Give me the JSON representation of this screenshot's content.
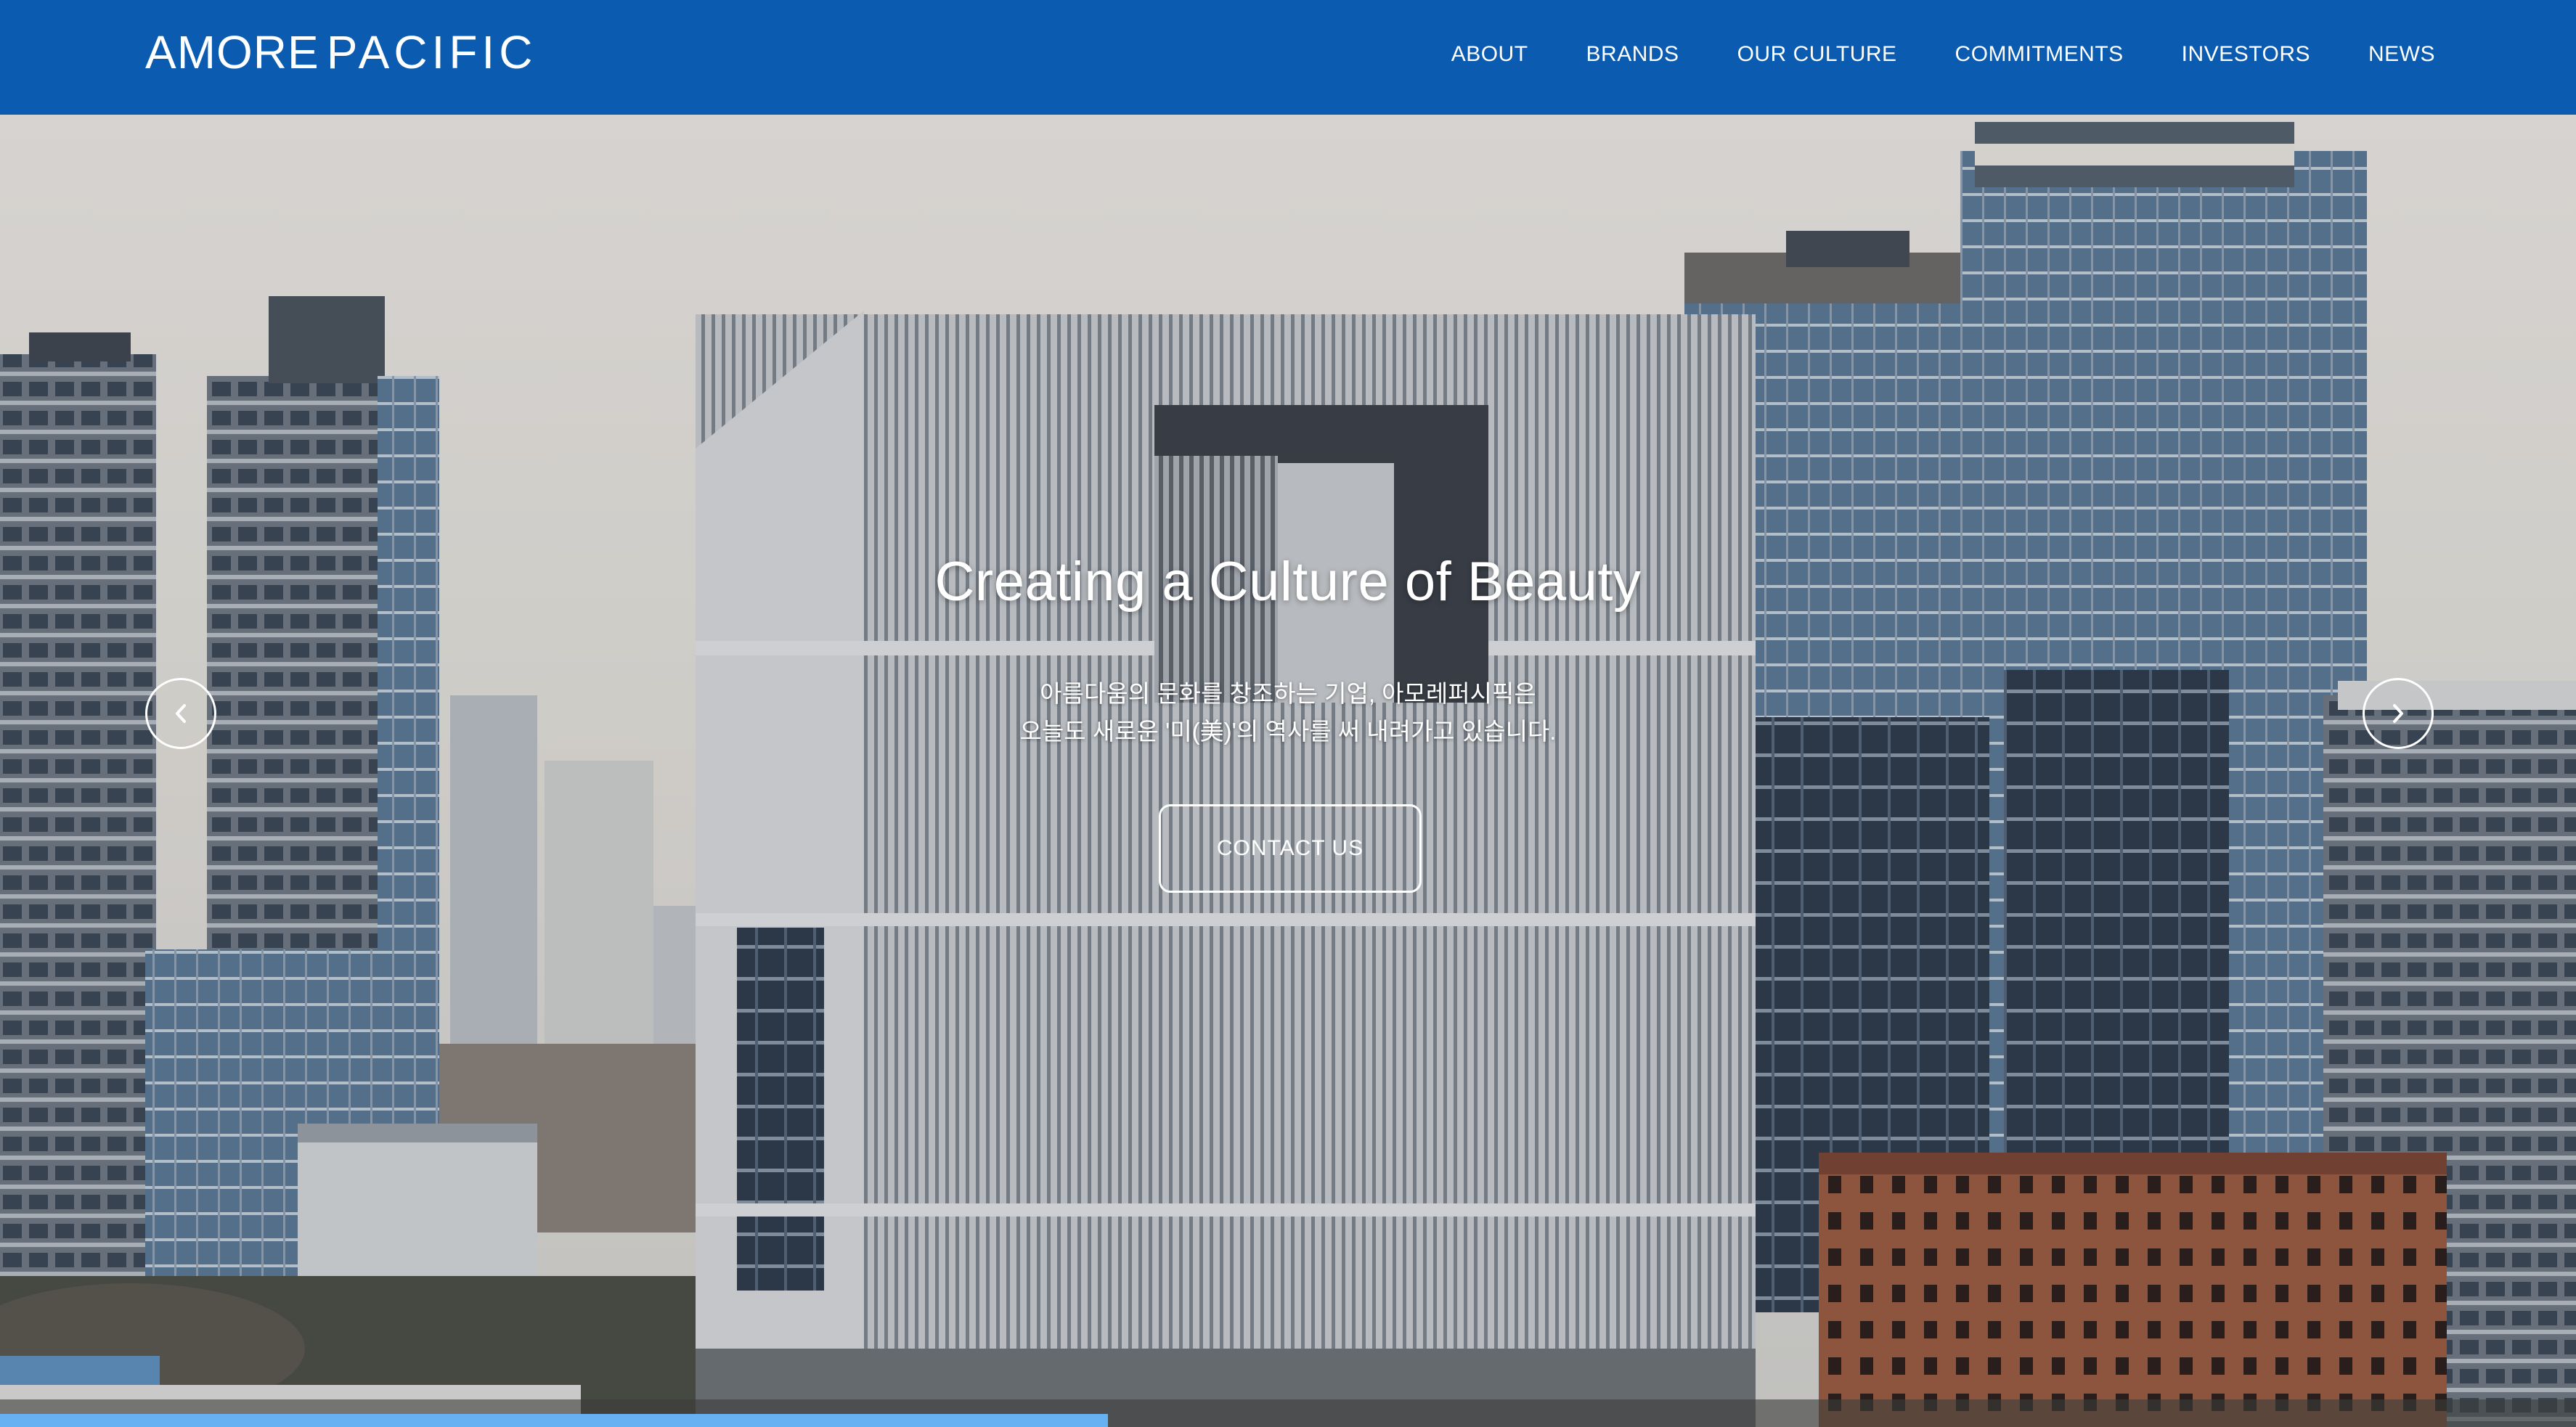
{
  "header": {
    "logo_amore": "AMORE",
    "logo_pacific": "PACIFIC",
    "brand_color": "#0b5cb0",
    "nav": [
      {
        "label": "ABOUT"
      },
      {
        "label": "BRANDS"
      },
      {
        "label": "OUR CULTURE"
      },
      {
        "label": "COMMITMENTS"
      },
      {
        "label": "INVESTORS"
      },
      {
        "label": "NEWS"
      }
    ]
  },
  "hero": {
    "title": "Creating a Culture of Beauty",
    "subtitle_line1": "아름다움의 문화를 창조하는 기업, 아모레퍼시픽은",
    "subtitle_line2": "오늘도 새로운 '미(美)'의 역사를 써 내려가고 있습니다.",
    "cta_label": "CONTACT US",
    "prev_icon": "chevron-left-icon",
    "next_icon": "chevron-right-icon",
    "slide_progress": 0.43,
    "progress_color": "#67b1f2"
  }
}
